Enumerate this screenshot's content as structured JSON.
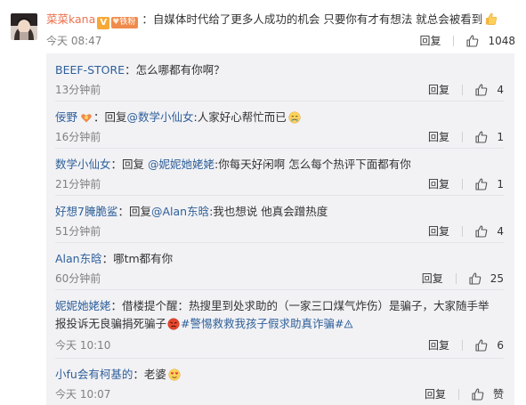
{
  "main_comment": {
    "username": "菜菜kana",
    "verified_badge": "V",
    "fan_badge": "铁粉",
    "text": "：自媒体时代给了更多人成功的机会 只要你有才有想法 就总会被看到",
    "emoji": "thumbs-up-emoji",
    "time": "今天 08:47",
    "reply_label": "回复",
    "like_count": "1048"
  },
  "replies": [
    {
      "username": "BEEF-STORE",
      "text": "：怎么哪都有你啊？",
      "time": "13分钟前",
      "reply_label": "回复",
      "like_count": "4"
    },
    {
      "username": "佞野",
      "badge_icon": "fan-badge-icon",
      "prefix": "：回复",
      "mention": "@数学小仙女",
      "text": ":人家好心帮忙而已",
      "emoji": "crying-emoji",
      "time": "16分钟前",
      "reply_label": "回复",
      "like_count": "1"
    },
    {
      "username": "数学小仙女",
      "prefix": "：回复",
      "mention": "@妮妮她姥姥",
      "text": ":你每天好闲啊 怎么每个热评下面都有你",
      "time": "21分钟前",
      "reply_label": "回复",
      "like_count": "1"
    },
    {
      "username": "好想7腌脆鲨",
      "prefix": "：回复",
      "mention": "@Alan东晗",
      "text": ":我也想说 他真会蹭热度",
      "time": "51分钟前",
      "reply_label": "回复",
      "like_count": "4"
    },
    {
      "username": "Alan东晗",
      "text": "：哪tm都有你",
      "time": "60分钟前",
      "reply_label": "回复",
      "like_count": "25"
    },
    {
      "username": "妮妮她姥姥",
      "text": "：借楼提个醒：热搜里到处求助的（一家三口煤气炸伤）是骗子，大家随手举",
      "text_line2": "报投诉无良骗捐死骗子",
      "emoji": "angry-emoji",
      "hashtag": "#警惕救救我孩子假求助真诈骗#",
      "hashtag_icon": "warning-icon",
      "time": "今天 10:10",
      "reply_label": "回复",
      "like_count": "6"
    },
    {
      "username": "小fu会有柯基的",
      "text": "：老婆",
      "emoji": "heart-eyes-emoji",
      "time": "今天 10:07",
      "reply_label": "回复",
      "like_count": "赞"
    }
  ],
  "colors": {
    "username": "#eb7350",
    "link": "#2e5f99",
    "reply_bg": "#f2f2f5",
    "muted": "#808080"
  }
}
